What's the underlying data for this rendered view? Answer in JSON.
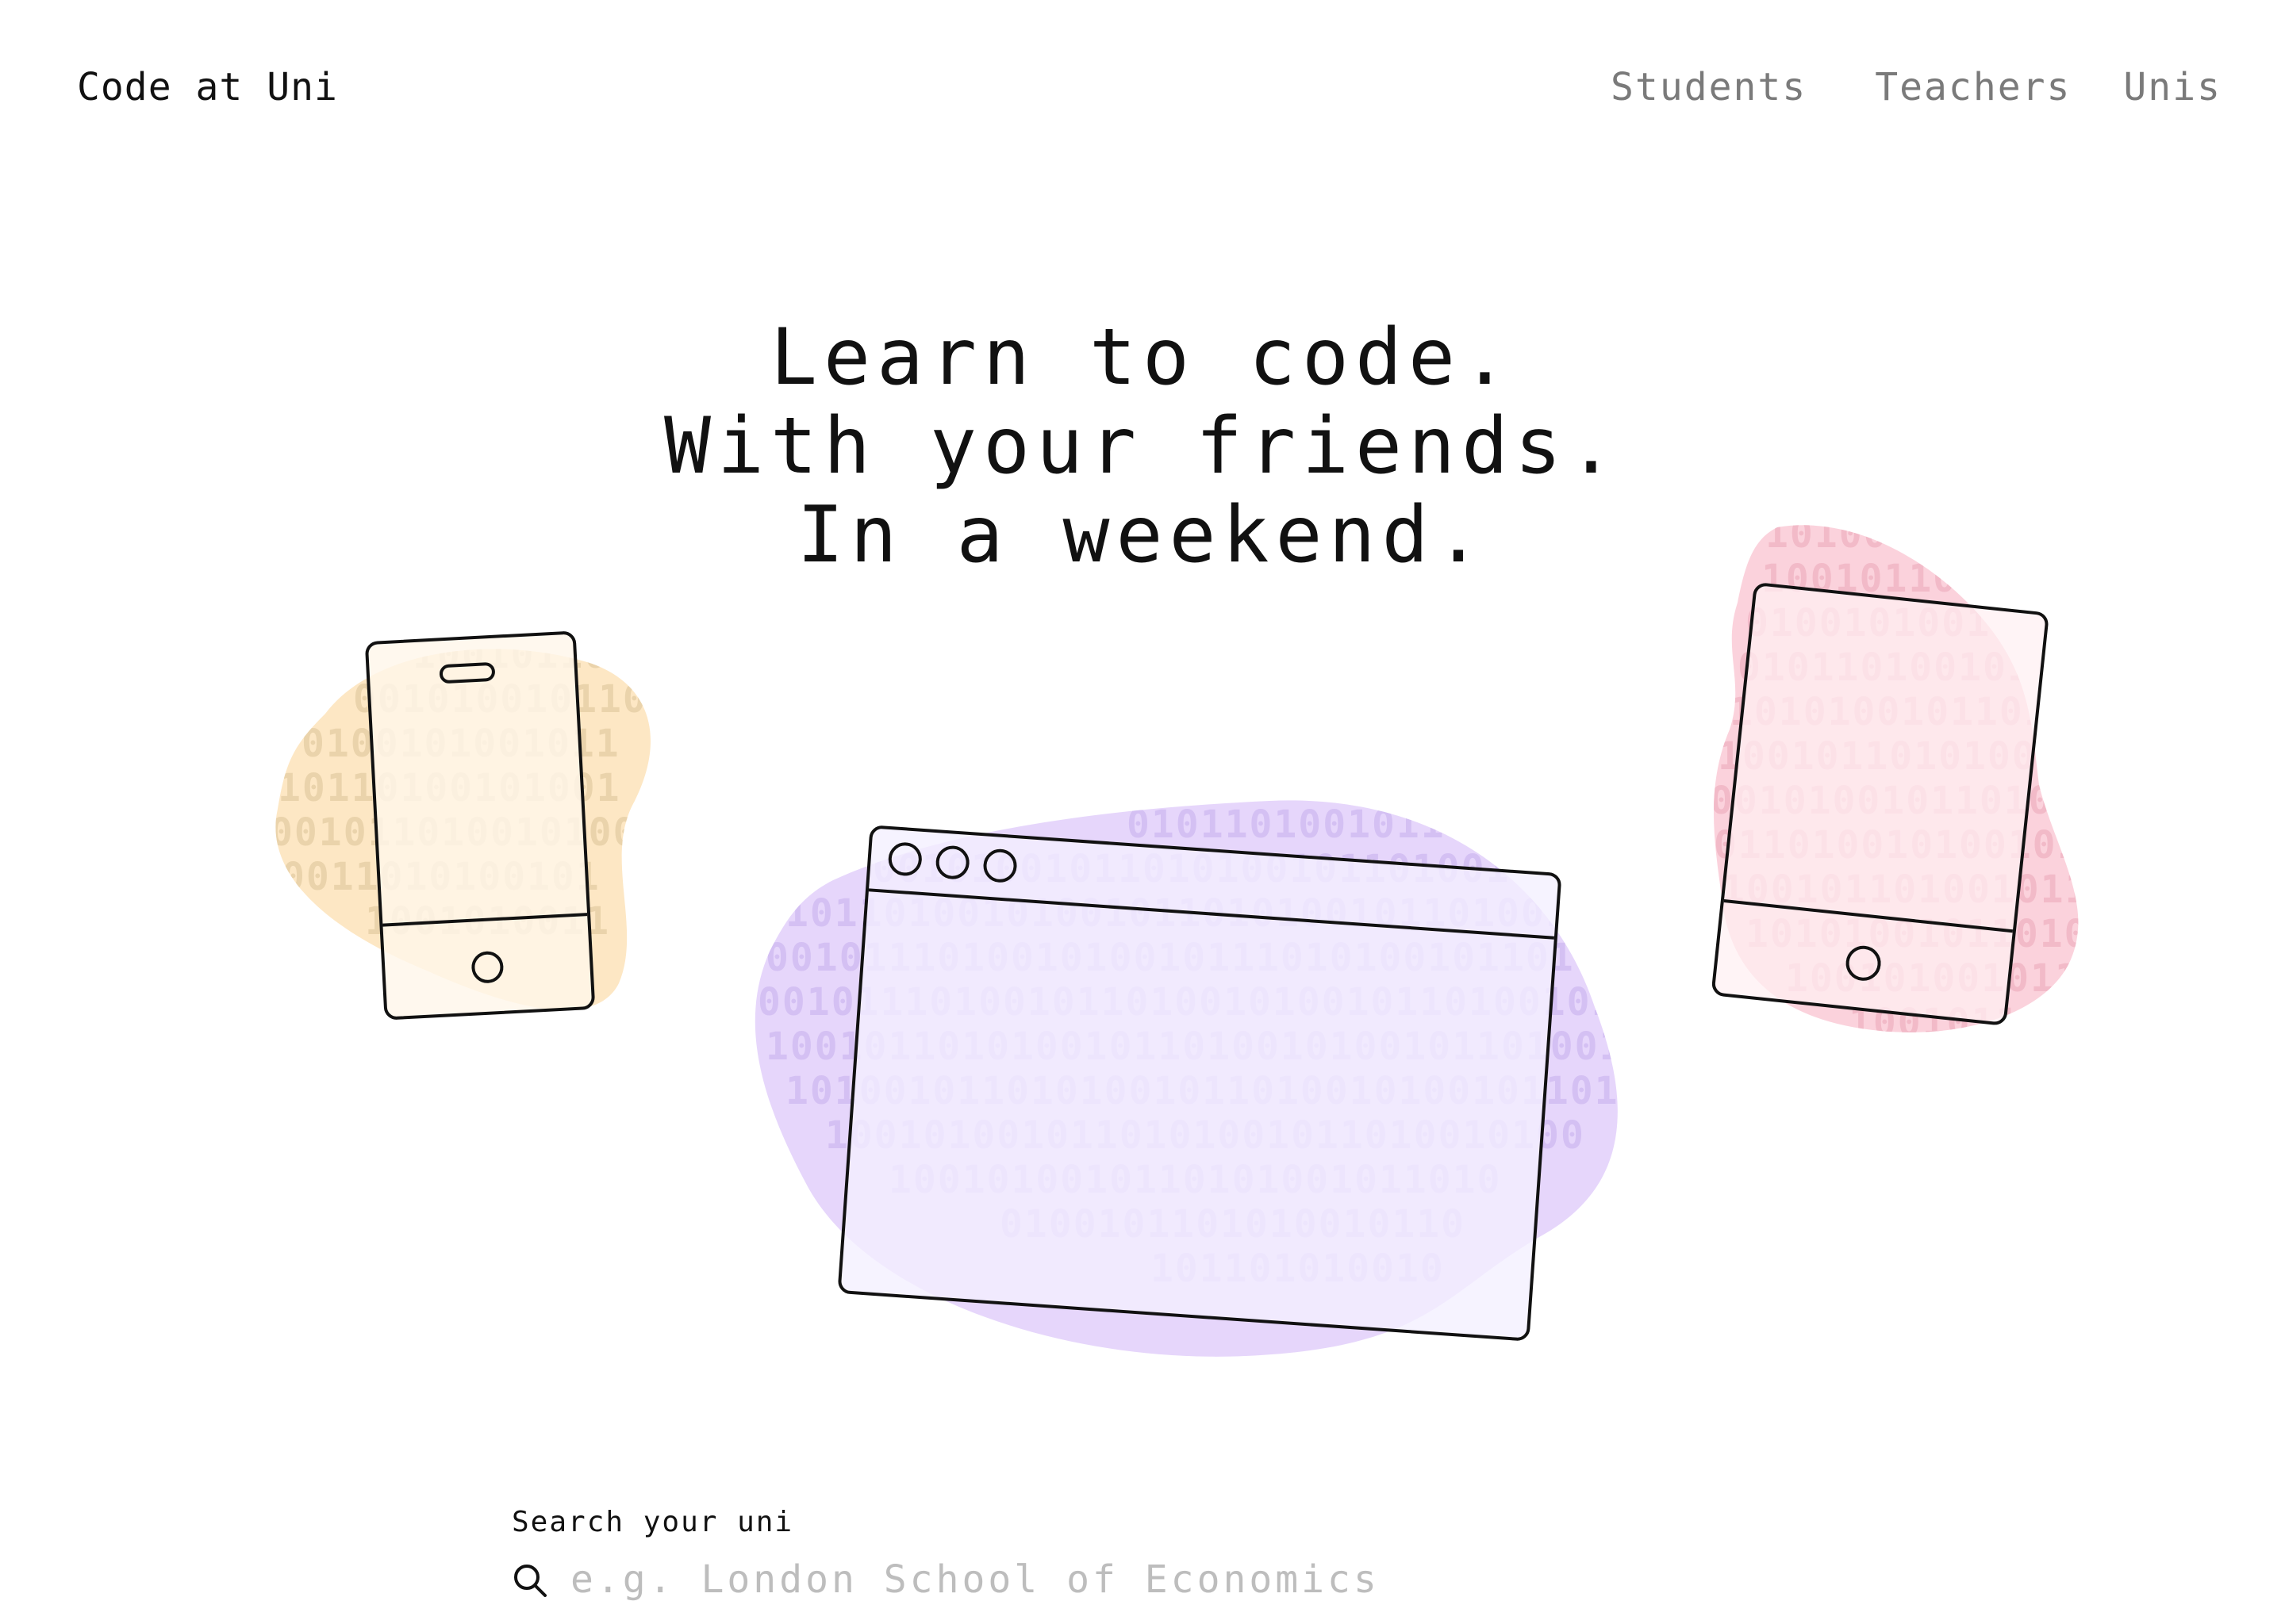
{
  "header": {
    "brand": "Code at Uni",
    "nav": [
      "Students",
      "Teachers",
      "Unis"
    ]
  },
  "hero": {
    "lines": [
      "Learn to code.",
      "With your friends.",
      "In a weekend."
    ]
  },
  "illustration": {
    "binary_left": [
      "1001011010",
      "001010010110101",
      "0100101001011",
      "10110100101001",
      "0010110100101001",
      "0011010100101",
      "1001010011"
    ],
    "binary_center": [
      "01011010010110100101",
      "0010100101101010010110100101",
      "1011010010100101101010010110100101",
      "0010111010010100101110101001011010",
      "0010111010010110100101001011010010110",
      "1001011010100101101001010010110100101",
      "10100101101010010110100101001011010",
      "1001010010110101001011010010100",
      "1001010010110101001011010",
      "0100101101010010110",
      "101101010010"
    ],
    "binary_right": [
      "1010010",
      "10010110100",
      "01001010010110",
      "0101101001011",
      "101010010110101",
      "1001011010100101",
      "00101001011010010",
      "0110100101001011010",
      "1001011010010110100",
      "1010100101101001",
      "1001010010110",
      "10010110"
    ],
    "colors": {
      "blob_left": "#fde7c4",
      "blob_center": "#e6d6fb",
      "blob_right": "#fbd2dc",
      "device_left_fill": "#fff6ea",
      "device_center_fill": "#f4efff",
      "device_right_fill": "#fff0f3",
      "outline": "#111111"
    }
  },
  "search": {
    "label": "Search your uni",
    "placeholder": "e.g. London School of Economics",
    "value": "",
    "icon": "search-icon"
  }
}
